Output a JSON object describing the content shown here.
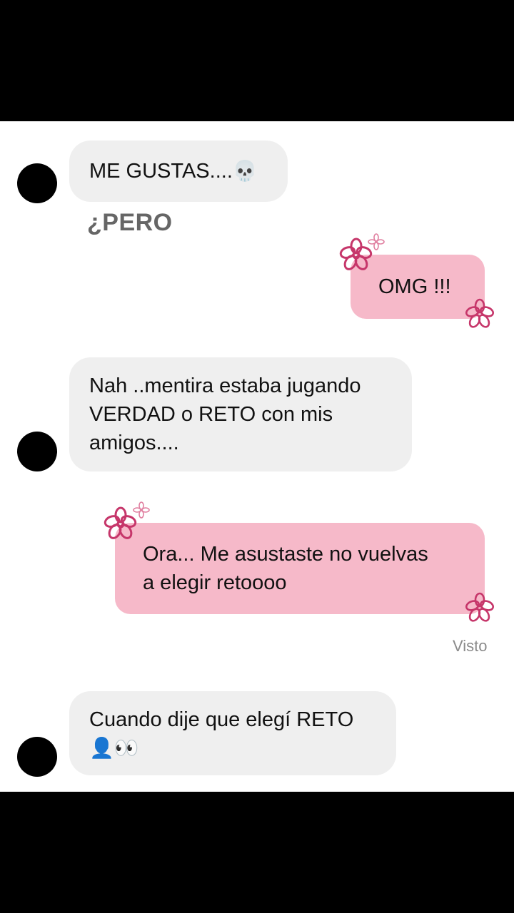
{
  "messages": [
    {
      "id": "m1",
      "from": "them",
      "text": "ME GUSTAS....",
      "emoji": "💀"
    },
    {
      "id": "m1b",
      "from": "them",
      "text": "¿PERO"
    },
    {
      "id": "m2",
      "from": "me",
      "text": "OMG !!!"
    },
    {
      "id": "m3",
      "from": "them",
      "lines": [
        "Nah ..mentira estaba jugando",
        "VERDAD o RETO con mis",
        "amigos...."
      ]
    },
    {
      "id": "m4",
      "from": "me",
      "lines": [
        "Ora... Me asustaste no vuelvas",
        "a elegir retoooo"
      ]
    },
    {
      "id": "m5",
      "from": "them",
      "lines": [
        "Cuando dije que elegí RETO"
      ],
      "emoji_line": "👤👀"
    }
  ],
  "status": {
    "seen_label": "Visto"
  },
  "colors": {
    "incoming_bubble": "#efefef",
    "outgoing_bubble": "#f6b9c9",
    "flower": "#c6366a",
    "background": "#ffffff",
    "letterbox": "#000000"
  },
  "icons": {
    "avatar": "avatar-circle",
    "flower": "flower-sticker"
  }
}
